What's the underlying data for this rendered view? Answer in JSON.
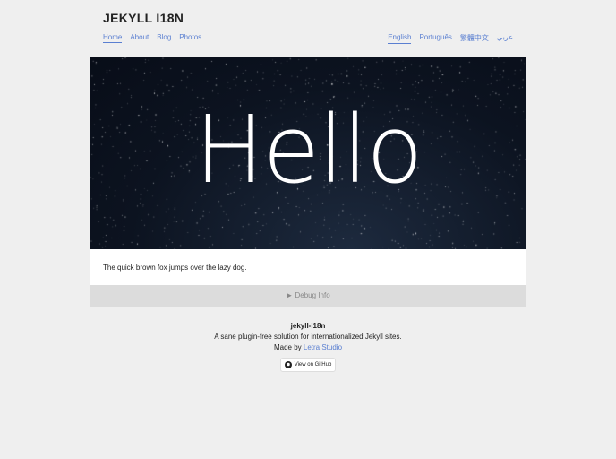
{
  "site_title": "JEKYLL I18N",
  "nav": [
    "Home",
    "About",
    "Blog",
    "Photos"
  ],
  "languages": [
    "English",
    "Português",
    "繁體中文",
    "عربي"
  ],
  "hero": {
    "text": "Hello"
  },
  "content": "The quick brown fox jumps over the lazy dog.",
  "debug": "► Debug Info",
  "footer": {
    "name": "jekyll-i18n",
    "tagline": "A sane plugin-free solution for internationalized Jekyll sites.",
    "made_by": "Made by ",
    "author": "Letra Studio",
    "github": "View on GitHub"
  }
}
